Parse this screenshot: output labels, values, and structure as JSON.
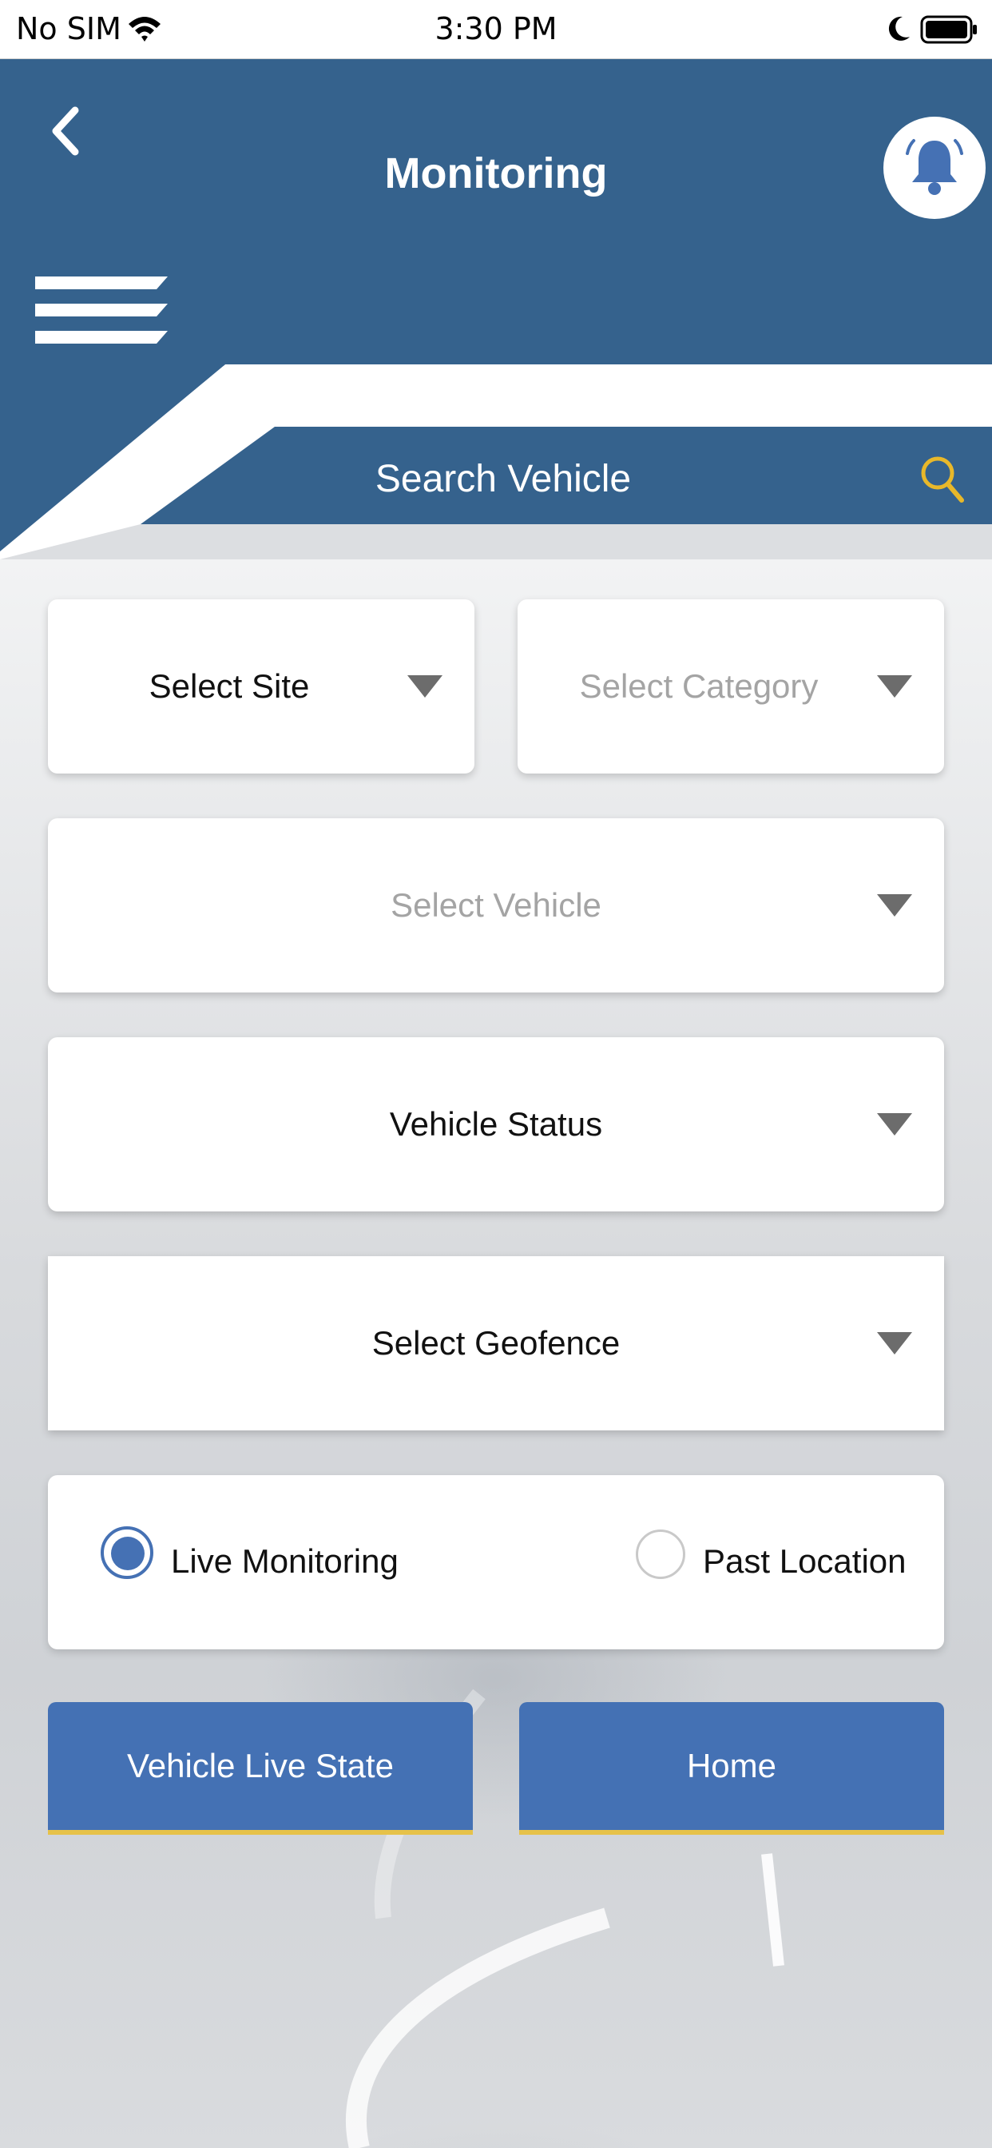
{
  "status_bar": {
    "carrier": "No SIM",
    "time": "3:30 PM"
  },
  "header": {
    "title": "Monitoring",
    "back_icon": "chevron-left-icon",
    "notification_icon": "bell-icon",
    "menu_icon": "hamburger-menu-icon"
  },
  "search": {
    "label": "Search Vehicle",
    "icon": "search-icon"
  },
  "filters": {
    "site": {
      "value": "Select Site"
    },
    "category": {
      "placeholder": "Select Category"
    },
    "vehicle": {
      "placeholder": "Select Vehicle"
    },
    "status": {
      "value": "Vehicle Status"
    },
    "geofence": {
      "value": "Select Geofence"
    }
  },
  "mode": {
    "options": [
      {
        "label": "Live Monitoring",
        "selected": true
      },
      {
        "label": "Past Location",
        "selected": false
      }
    ]
  },
  "actions": {
    "live_state": "Vehicle Live State",
    "home": "Home"
  },
  "colors": {
    "header": "#35628d",
    "button": "#4471b4",
    "accent": "#e6c24a",
    "search_icon": "#e8b82a"
  }
}
